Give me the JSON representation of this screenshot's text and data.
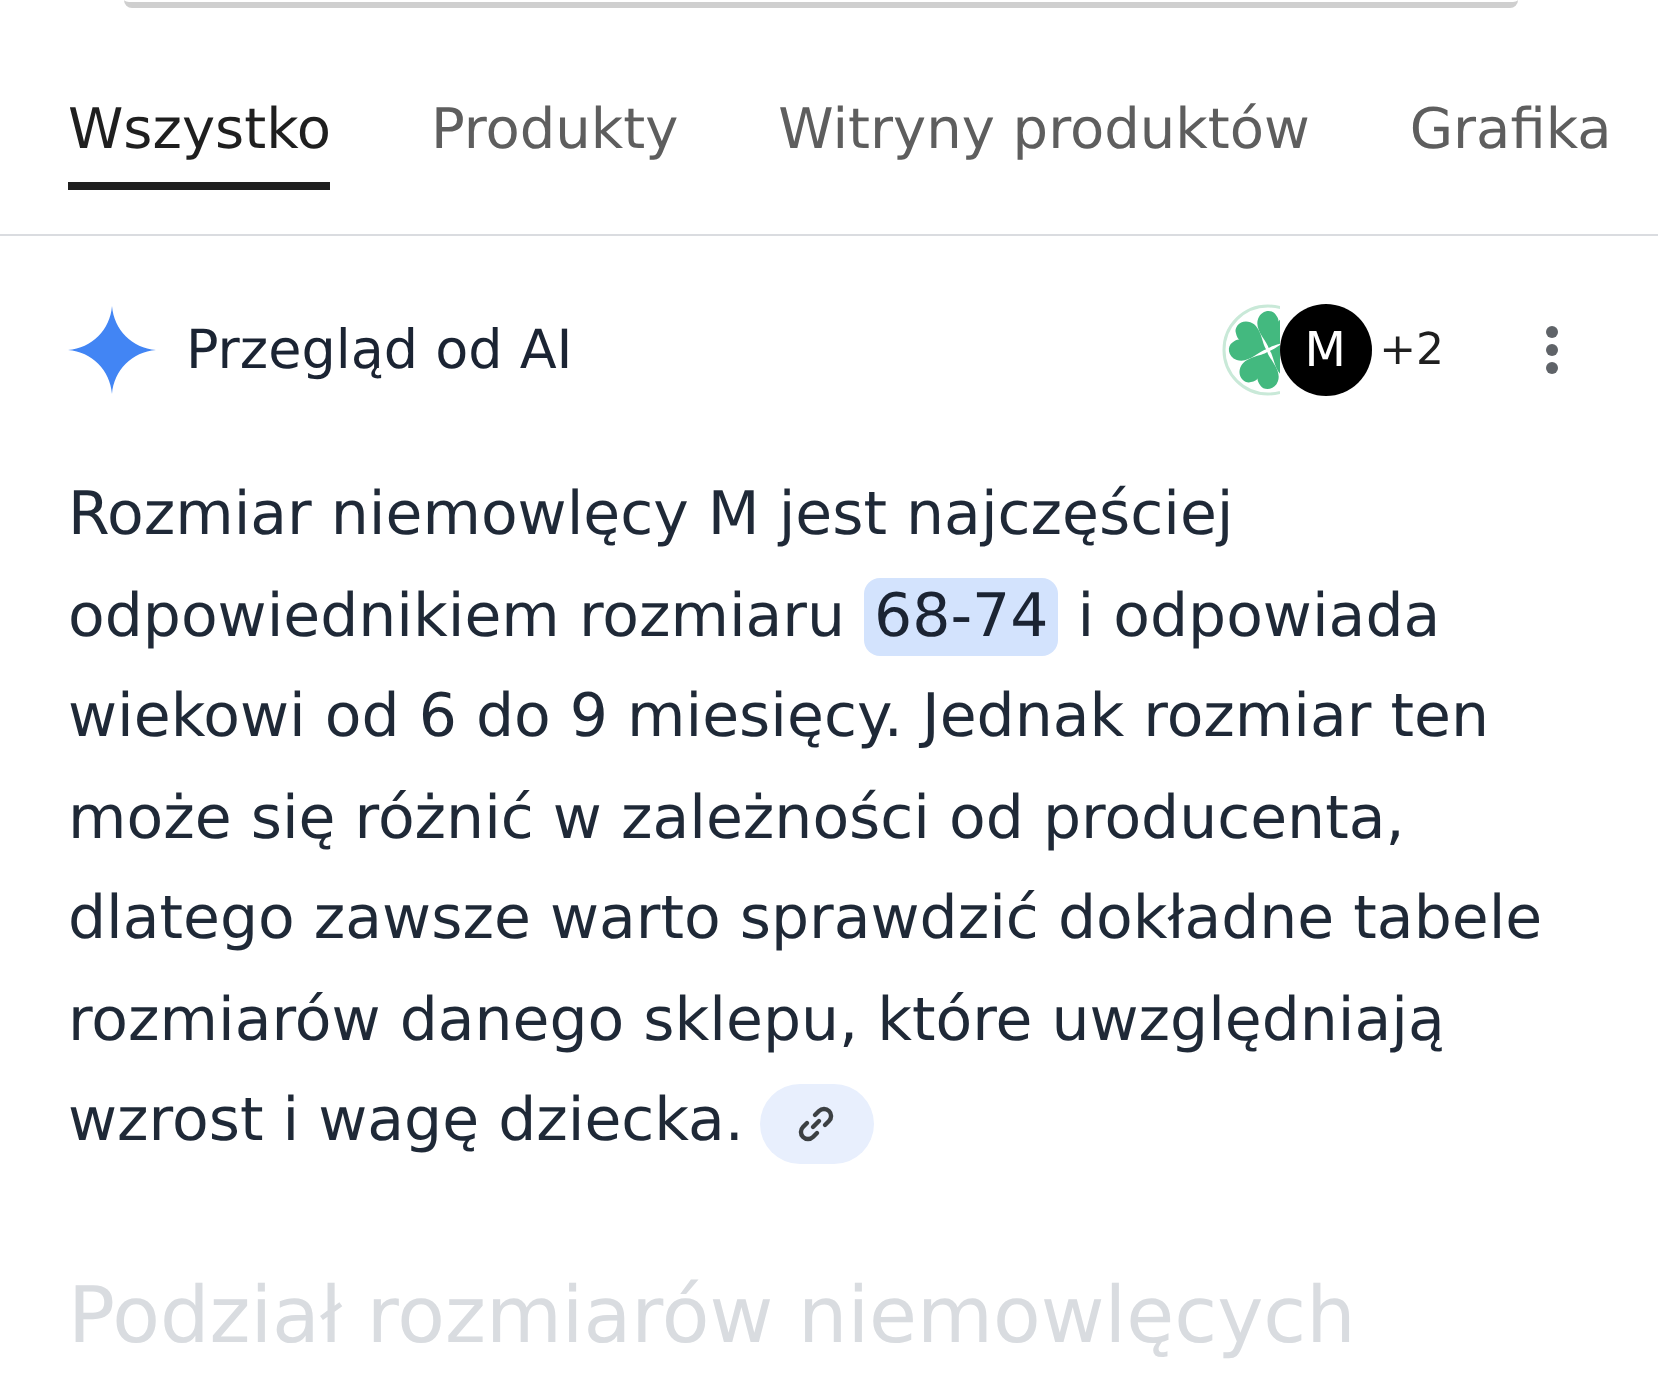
{
  "tabs": [
    {
      "label": "Wszystko",
      "selected": true
    },
    {
      "label": "Produkty",
      "selected": false
    },
    {
      "label": "Witryny produktów",
      "selected": false
    },
    {
      "label": "Grafika",
      "selected": false
    }
  ],
  "ai_overview": {
    "title": "Przegląd od AI",
    "sources": [
      {
        "kind": "clover"
      },
      {
        "kind": "letter",
        "letter": "M"
      }
    ],
    "more_sources": "+2",
    "paragraph": [
      {
        "kind": "text",
        "text": "Rozmiar niemowlęcy M jest najczęściej odpowiednikiem rozmiaru "
      },
      {
        "kind": "highlight",
        "text": "68-74"
      },
      {
        "kind": "text",
        "text": " i odpowiada wiekowi od 6 do 9 miesięcy. Jednak rozmiar ten może się różnić w zależności od producenta, dlatego zawsze warto sprawdzić dokładne tabele rozmiarów danego sklepu, które uwzględniają wzrost i wagę dziecka."
      }
    ],
    "next_heading": "Podział rozmiarów niemowlęcych"
  }
}
